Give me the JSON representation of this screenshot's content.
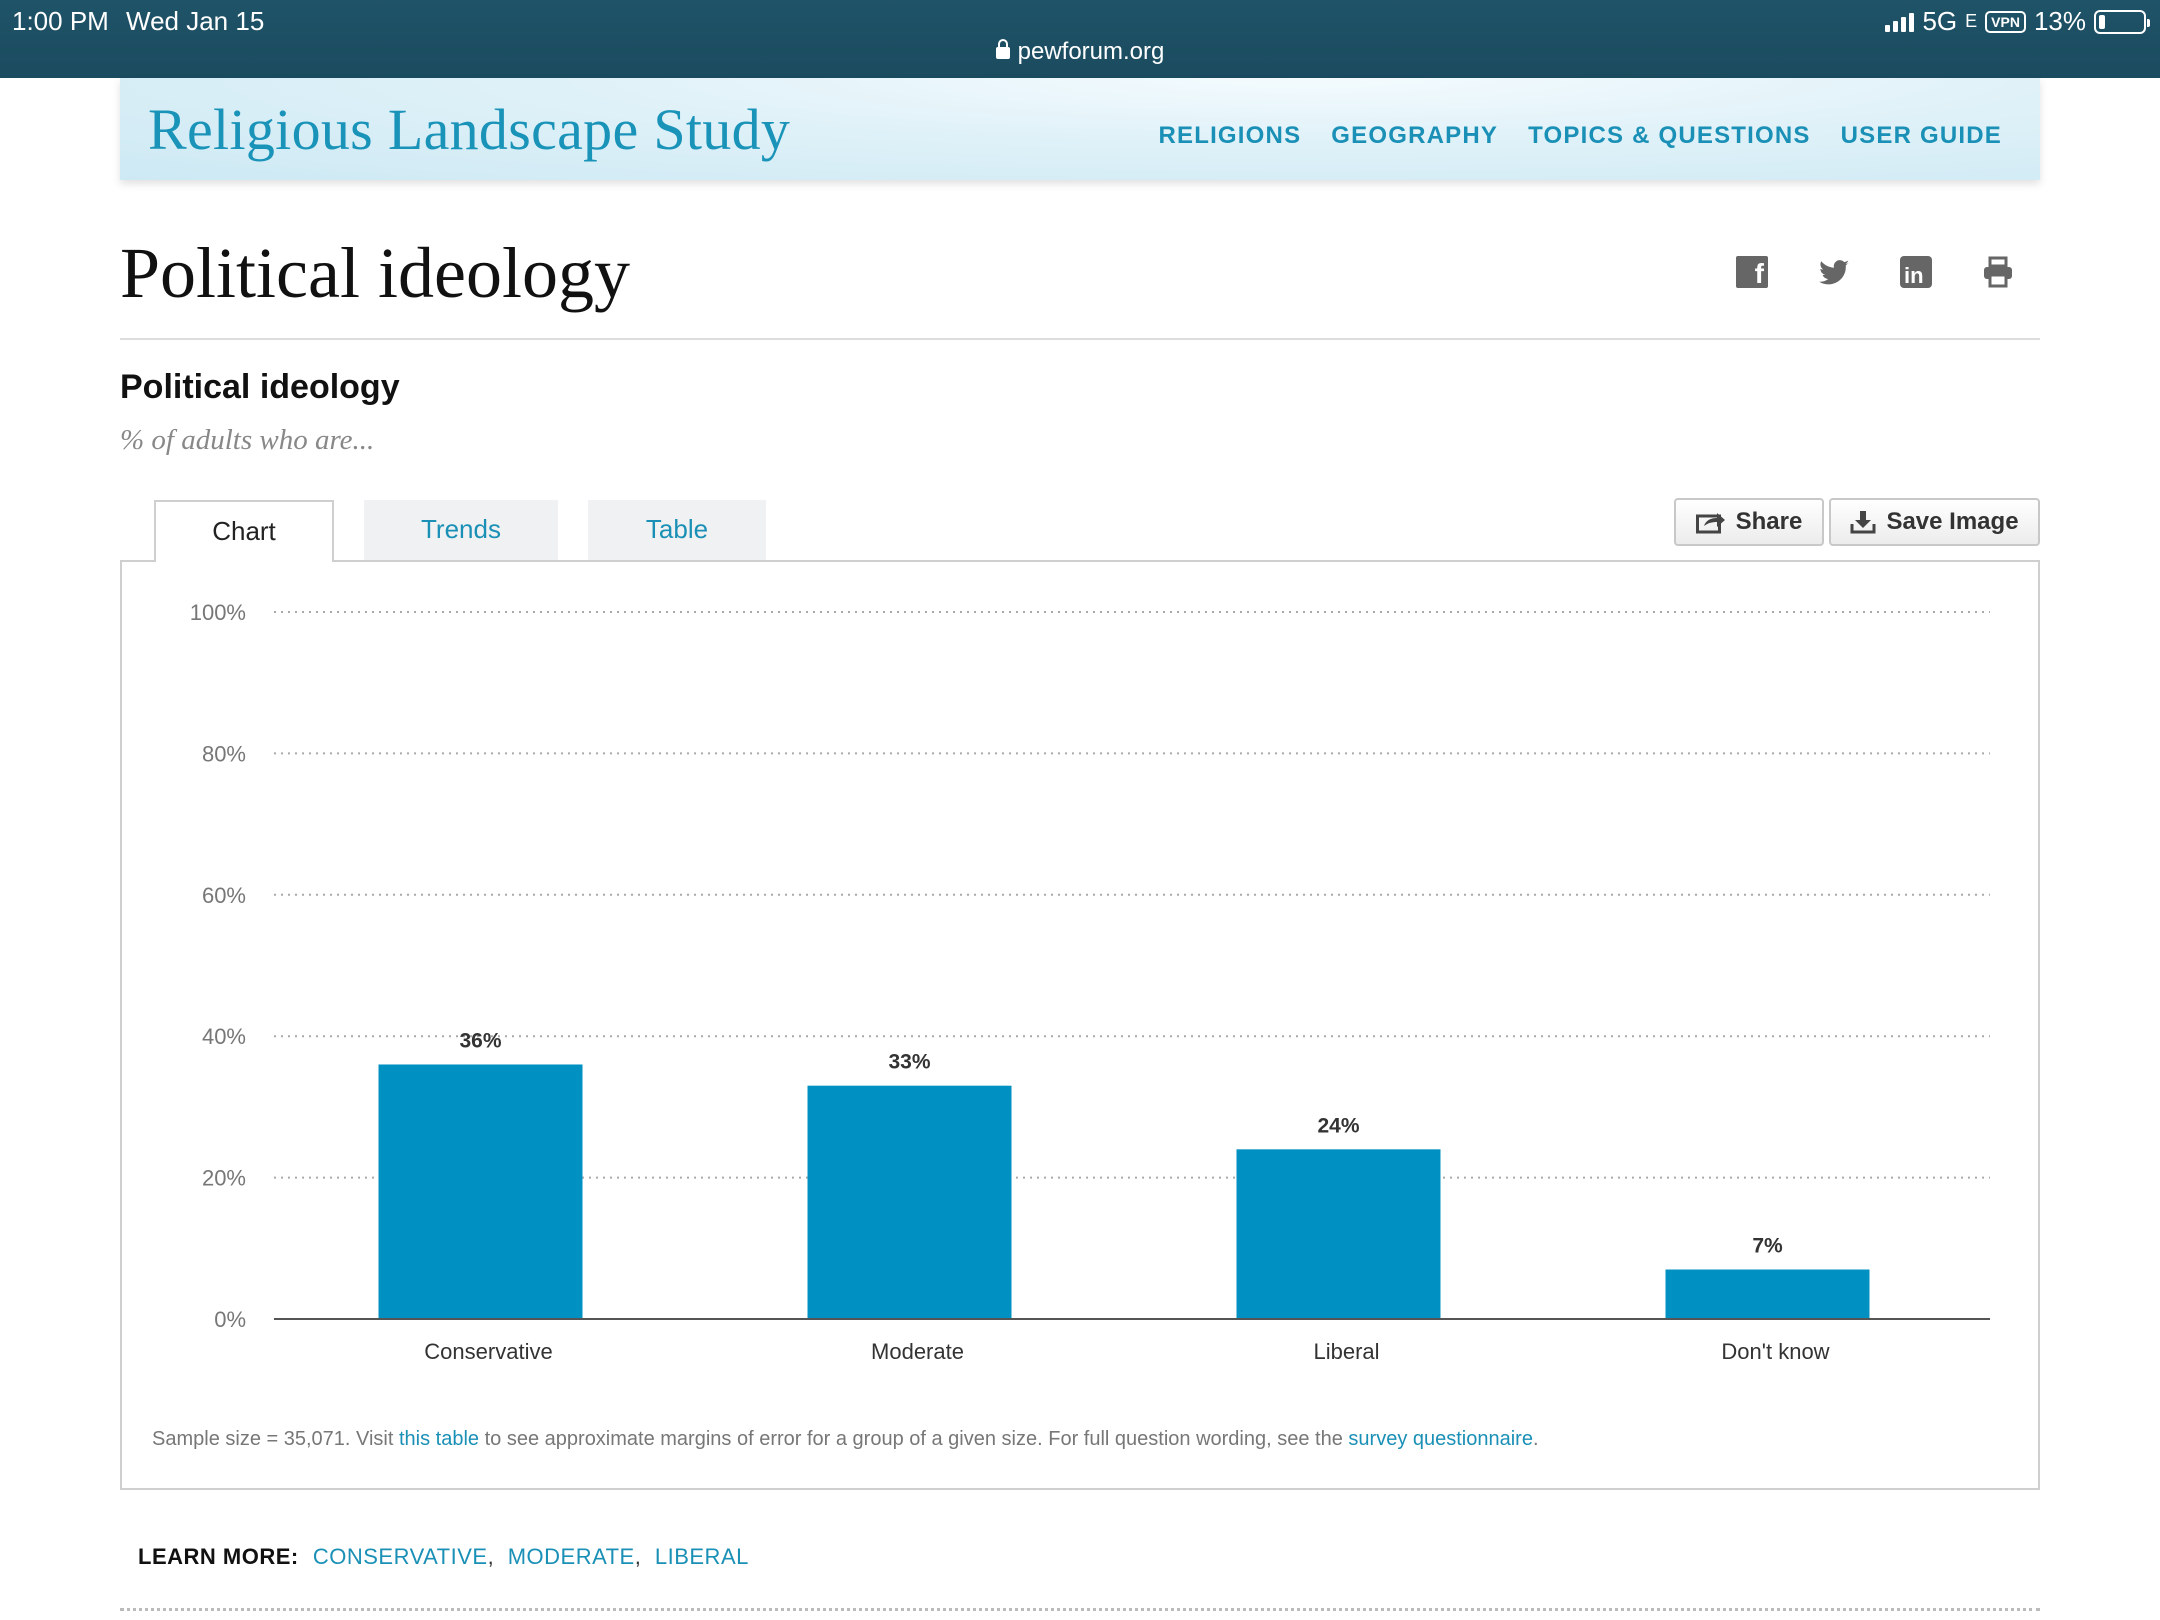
{
  "status_bar": {
    "time": "1:00 PM",
    "date": "Wed Jan 15",
    "network": "5G",
    "network_suffix": "E",
    "vpn": "VPN",
    "battery": "13%",
    "url": "pewforum.org"
  },
  "header": {
    "site_title": "Religious Landscape Study",
    "nav": [
      "RELIGIONS",
      "GEOGRAPHY",
      "TOPICS & QUESTIONS",
      "USER GUIDE"
    ]
  },
  "page": {
    "title": "Political ideology",
    "social_icons": [
      "facebook-icon",
      "twitter-icon",
      "linkedin-icon",
      "print-icon"
    ]
  },
  "section": {
    "title": "Political ideology",
    "subtitle": "% of adults who are..."
  },
  "tabs": [
    "Chart",
    "Trends",
    "Table"
  ],
  "actions": {
    "share_label": "Share",
    "save_label": "Save Image"
  },
  "chart_data": {
    "type": "bar",
    "categories": [
      "Conservative",
      "Moderate",
      "Liberal",
      "Don't know"
    ],
    "values": [
      36,
      33,
      24,
      7
    ],
    "value_labels": [
      "36%",
      "33%",
      "24%",
      "7%"
    ],
    "ylim": [
      0,
      100
    ],
    "yticks": [
      0,
      20,
      40,
      60,
      80,
      100
    ],
    "ytick_labels": [
      "0%",
      "20%",
      "40%",
      "60%",
      "80%",
      "100%"
    ],
    "grid": true,
    "bar_color": "#0091c2"
  },
  "note": {
    "prefix": "Sample size = 35,071. Visit ",
    "link1": "this table",
    "middle": " to see approximate margins of error for a group of a given size. For full question wording, see the ",
    "link2": "survey questionnaire",
    "suffix": "."
  },
  "learn_more": {
    "label": "LEARN MORE:",
    "links": [
      "CONSERVATIVE",
      "MODERATE",
      "LIBERAL"
    ]
  },
  "colors": {
    "accent": "#1a90b6",
    "status_bar": "#1b4b5f"
  }
}
